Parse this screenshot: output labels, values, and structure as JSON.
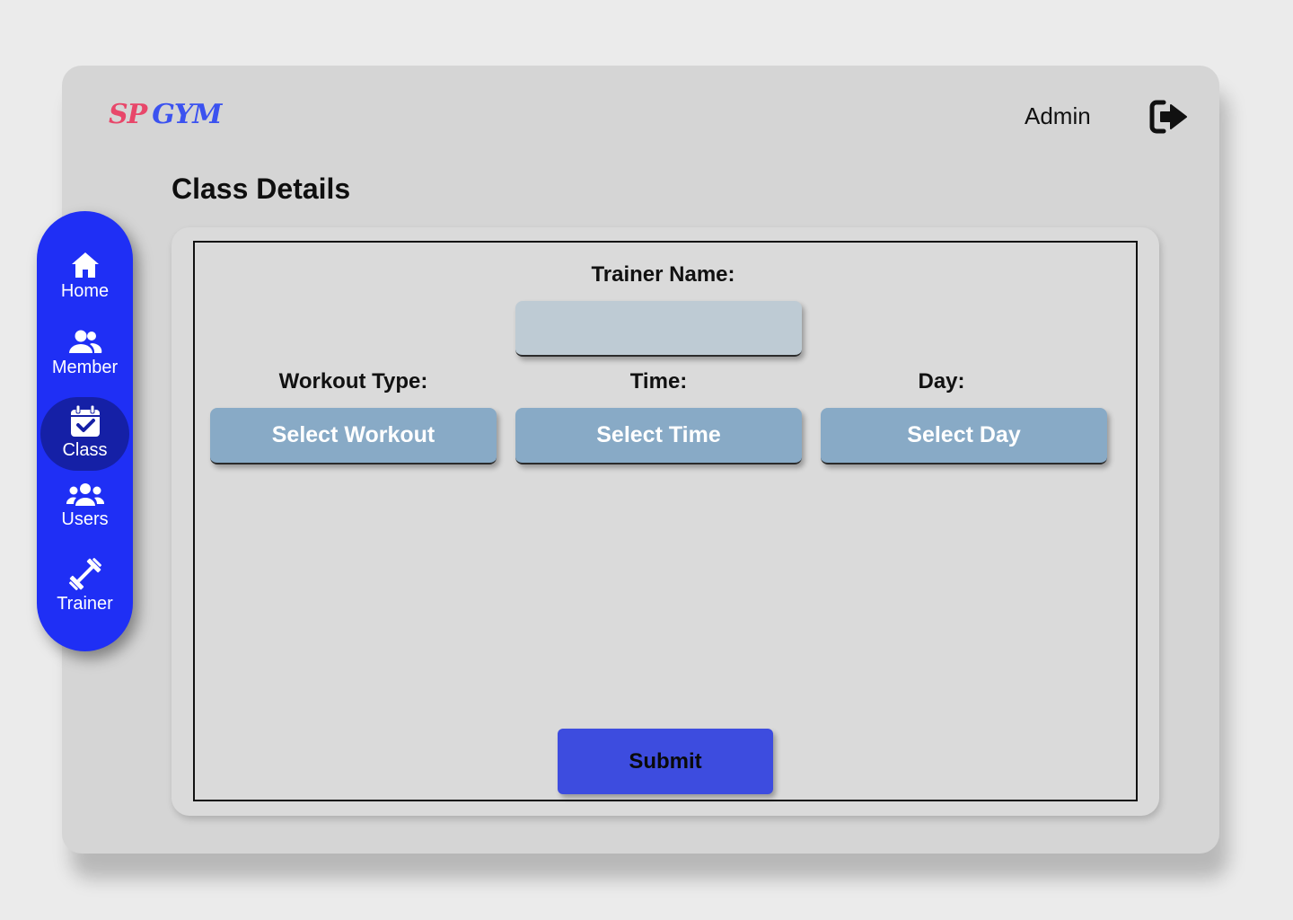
{
  "brand": {
    "part1": "SP",
    "part2": "GYM",
    "colors": {
      "part1": "#e8476a",
      "part2": "#3b52f0"
    }
  },
  "header": {
    "user_label": "Admin",
    "logout_icon": "logout-icon"
  },
  "page": {
    "title": "Class Details"
  },
  "sidebar": {
    "color": "#1f2ff5",
    "active_color": "#1520a6",
    "items": [
      {
        "label": "Home",
        "icon": "home-icon",
        "active": false
      },
      {
        "label": "Member",
        "icon": "member-icon",
        "active": false
      },
      {
        "label": "Class",
        "icon": "calendar-check-icon",
        "active": true
      },
      {
        "label": "Users",
        "icon": "users-group-icon",
        "active": false
      },
      {
        "label": "Trainer",
        "icon": "dumbbell-icon",
        "active": false
      }
    ]
  },
  "form": {
    "trainer_name_label": "Trainer Name:",
    "trainer_name_value": "",
    "workout_type_label": "Workout Type:",
    "workout_select_label": "Select Workout",
    "time_label": "Time:",
    "time_select_label": "Select Time",
    "day_label": "Day:",
    "day_select_label": "Select Day",
    "submit_label": "Submit",
    "colors": {
      "input": "#becbd4",
      "select": "#88aac6",
      "submit": "#3d4cdf"
    }
  }
}
